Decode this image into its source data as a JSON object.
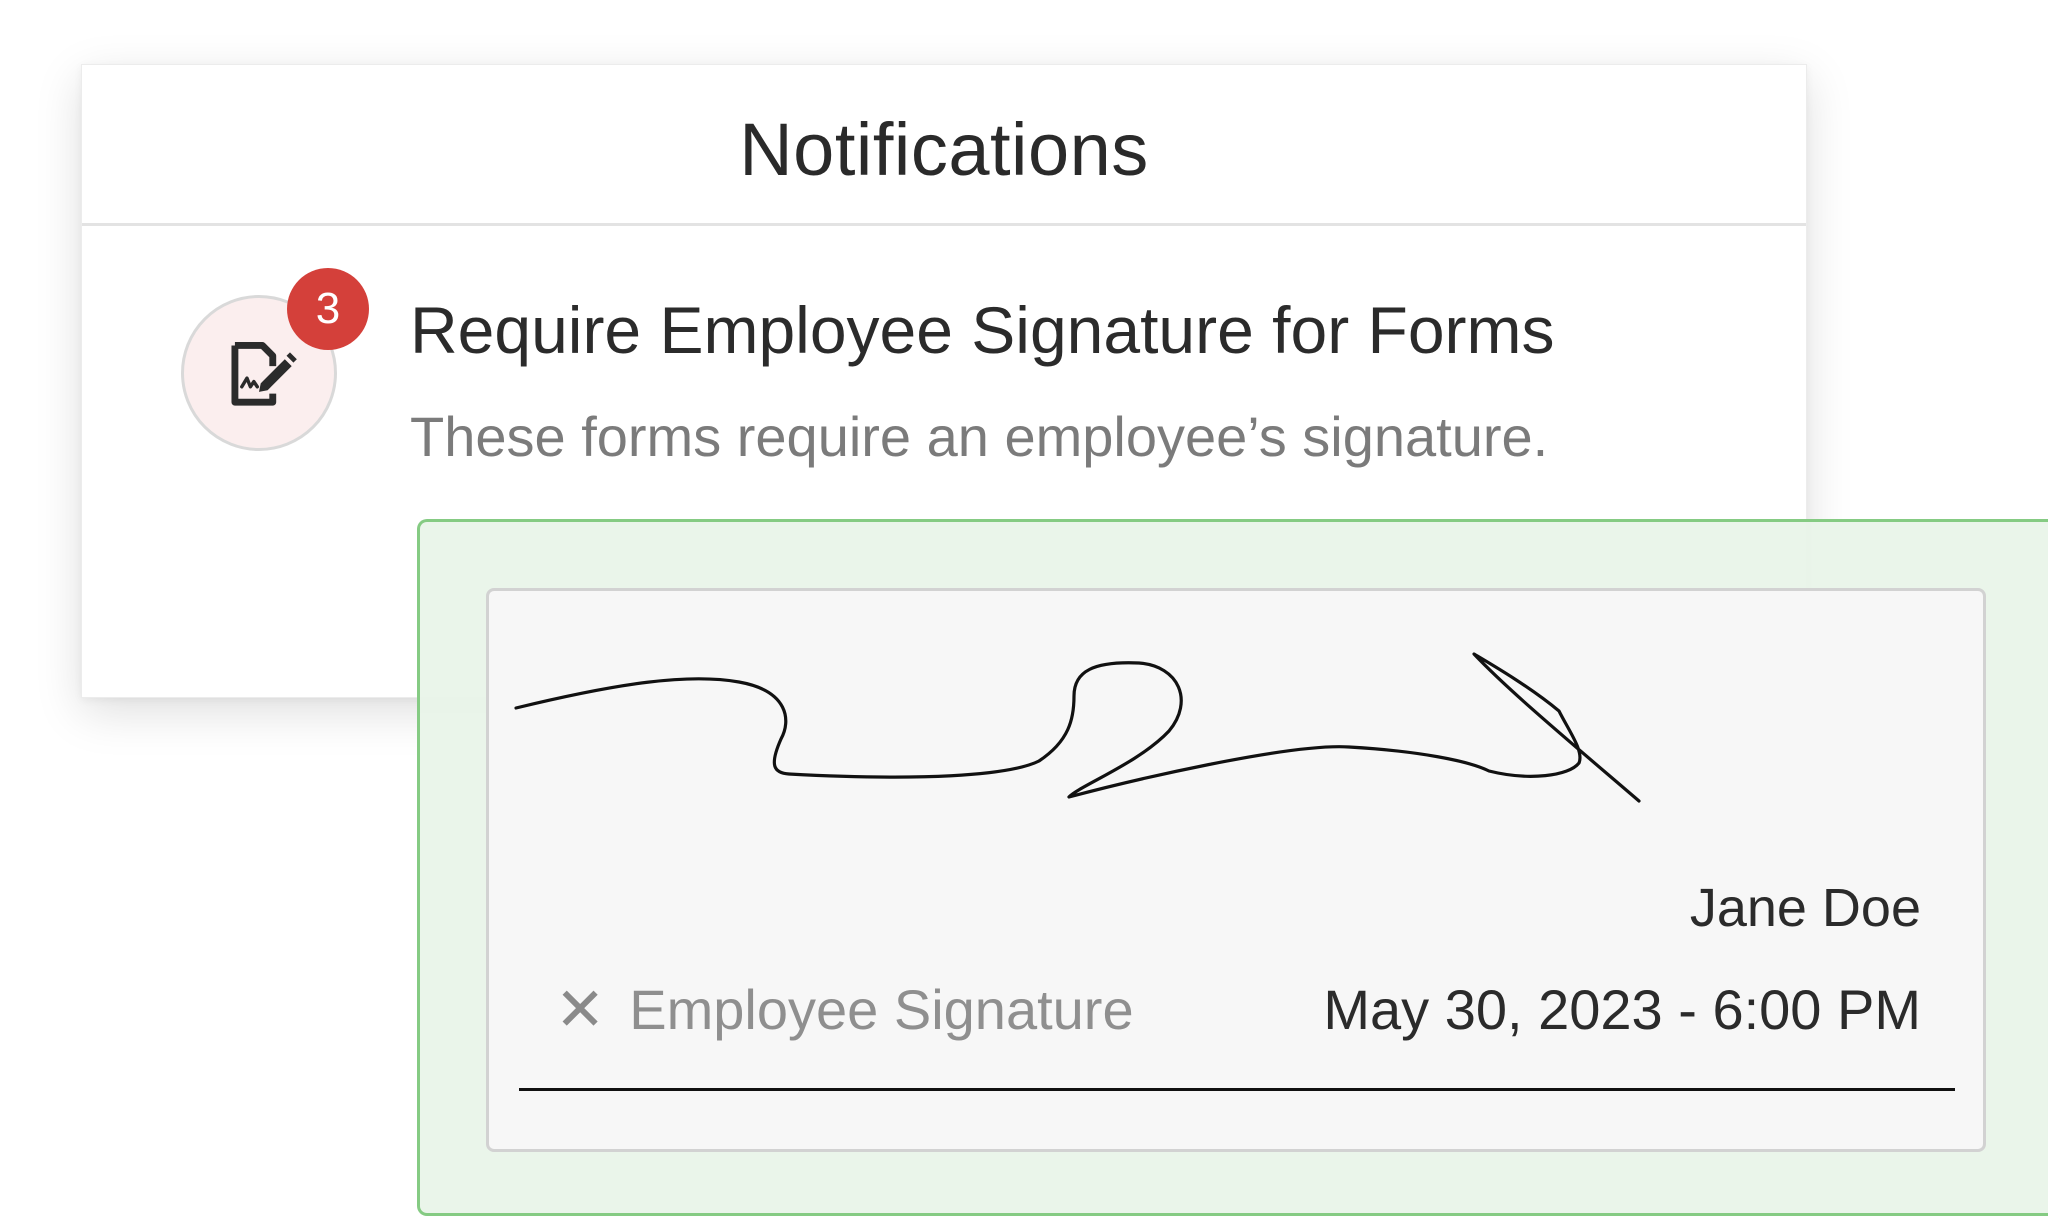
{
  "notifications": {
    "title": "Notifications",
    "item": {
      "icon": "signature-document-icon",
      "badge_count": "3",
      "title": "Require Employee Signature for Forms",
      "description": "These forms require an employee’s signature."
    }
  },
  "signature": {
    "signer_name": "Jane Doe",
    "clear_icon": "close-icon",
    "field_label": "Employee Signature",
    "timestamp": "May 30, 2023 - 6:00 PM"
  },
  "colors": {
    "badge": "#d4403a",
    "overlay_border": "#85cb83",
    "overlay_fill": "#e9f4e9",
    "icon_circle": "#fbeeee"
  }
}
